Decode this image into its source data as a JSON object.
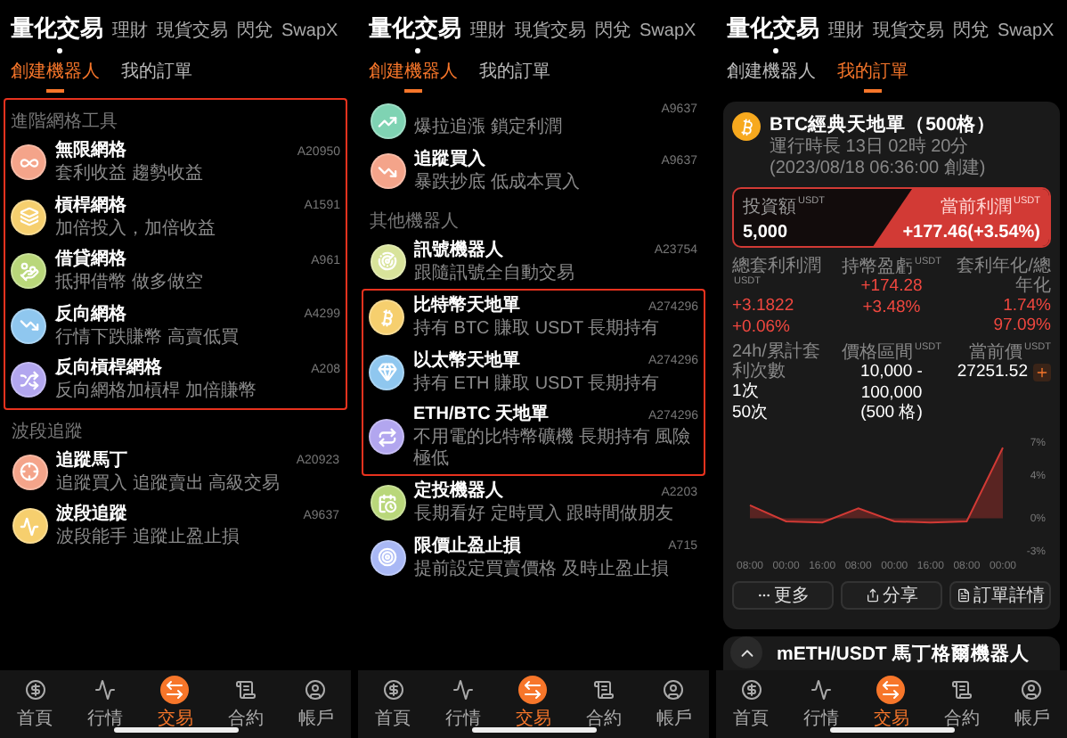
{
  "panels": [
    {
      "kind": "robots",
      "tabs": [
        {
          "label": "量化交易",
          "selected": true
        },
        {
          "label": "理財",
          "selected": false
        },
        {
          "label": "現貨交易",
          "selected": false
        },
        {
          "label": "閃兌",
          "selected": false
        },
        {
          "label": "SwapX",
          "selected": false
        }
      ],
      "subtabs": [
        {
          "label": "創建機器人",
          "selected": true
        },
        {
          "label": "我的訂單",
          "selected": false
        }
      ],
      "list": [
        {
          "kind": "section",
          "label": "進階網格工具",
          "highlighted": true
        },
        {
          "kind": "item",
          "title": "無限網格",
          "subtitle": "套利收益 趨勢收益",
          "code": "A20950",
          "color": "#f4a48a",
          "highlighted": true
        },
        {
          "kind": "item",
          "title": "槓桿網格",
          "subtitle": "加倍投入，加倍收益",
          "code": "A1591",
          "color": "#f6cf6e",
          "highlighted": true
        },
        {
          "kind": "item",
          "title": "借貸網格",
          "subtitle": "抵押借幣 做多做空",
          "code": "A961",
          "color": "#b9d77a",
          "highlighted": true
        },
        {
          "kind": "item",
          "title": "反向網格",
          "subtitle": "行情下跌賺幣 高賣低買",
          "code": "A4299",
          "color": "#8fc7ef",
          "highlighted": true
        },
        {
          "kind": "item",
          "title": "反向槓桿網格",
          "subtitle": "反向網格加槓桿 加倍賺幣",
          "code": "A208",
          "color": "#b2a6ef",
          "highlighted": true
        },
        {
          "kind": "section",
          "label": "波段追蹤",
          "highlighted": false
        },
        {
          "kind": "item",
          "title": "追蹤馬丁",
          "subtitle": "追蹤買入 追蹤賣出 高級交易",
          "code": "A20923",
          "color": "#f4a48a",
          "highlighted": false
        },
        {
          "kind": "item",
          "title": "波段追蹤",
          "subtitle": "波段能手 追蹤止盈止損",
          "code": "A9637",
          "color": "#f6cf6e",
          "highlighted": false
        }
      ],
      "nav": [
        {
          "label": "首頁",
          "selected": false
        },
        {
          "label": "行情",
          "selected": false
        },
        {
          "label": "交易",
          "selected": true
        },
        {
          "label": "合約",
          "selected": false
        },
        {
          "label": "帳戶",
          "selected": false
        }
      ]
    },
    {
      "kind": "robots",
      "tabs": [
        {
          "label": "量化交易",
          "selected": true
        },
        {
          "label": "理財",
          "selected": false
        },
        {
          "label": "現貨交易",
          "selected": false
        },
        {
          "label": "閃兌",
          "selected": false
        },
        {
          "label": "SwapX",
          "selected": false
        }
      ],
      "subtabs": [
        {
          "label": "創建機器人",
          "selected": true
        },
        {
          "label": "我的訂單",
          "selected": false
        }
      ],
      "list": [
        {
          "kind": "item",
          "subtitle": "爆拉追漲 鎖定利潤",
          "code": "A9637",
          "color": "#7fd3b3",
          "highlighted": false
        },
        {
          "kind": "item",
          "title": "追蹤買入",
          "subtitle": "暴跌抄底 低成本買入",
          "code": "A9637",
          "color": "#f4a48a",
          "highlighted": false
        },
        {
          "kind": "section",
          "label": "其他機器人",
          "highlighted": false
        },
        {
          "kind": "item",
          "title": "訊號機器人",
          "subtitle": "跟隨訊號全自動交易",
          "code": "A23754",
          "color": "#d8e39a",
          "highlighted": false
        },
        {
          "kind": "item",
          "title": "比特幣天地單",
          "subtitle": "持有 BTC 賺取 USDT 長期持有",
          "code": "A274296",
          "color": "#f6cf6e",
          "highlighted": true
        },
        {
          "kind": "item",
          "title": "以太幣天地單",
          "subtitle": "持有 ETH 賺取 USDT 長期持有",
          "code": "A274296",
          "color": "#8fc7ef",
          "highlighted": true
        },
        {
          "kind": "item",
          "title": "ETH/BTC 天地單",
          "subtitle": "不用電的比特幣礦機 長期持有 風險極低",
          "code": "A274296",
          "color": "#b2a6ef",
          "highlighted": true
        },
        {
          "kind": "item",
          "title": "定投機器人",
          "subtitle": "長期看好 定時買入 跟時間做朋友",
          "code": "A2203",
          "color": "#b9d77a",
          "highlighted": false
        },
        {
          "kind": "item",
          "title": "限價止盈止損",
          "subtitle": "提前設定買賣價格 及時止盈止損",
          "code": "A715",
          "color": "#a9b8f5",
          "highlighted": false
        }
      ],
      "nav": [
        {
          "label": "首頁",
          "selected": false
        },
        {
          "label": "行情",
          "selected": false
        },
        {
          "label": "交易",
          "selected": true
        },
        {
          "label": "合約",
          "selected": false
        },
        {
          "label": "帳戶",
          "selected": false
        }
      ]
    },
    {
      "kind": "orders",
      "tabs": [
        {
          "label": "量化交易",
          "selected": true
        },
        {
          "label": "理財",
          "selected": false
        },
        {
          "label": "現貨交易",
          "selected": false
        },
        {
          "label": "閃兌",
          "selected": false
        },
        {
          "label": "SwapX",
          "selected": false
        }
      ],
      "subtabs": [
        {
          "label": "創建機器人",
          "selected": false
        },
        {
          "label": "我的訂單",
          "selected": true
        }
      ],
      "order": {
        "title": "BTC經典天地單（500格）",
        "runtime": "運行時長 13日 02時 20分(2023/08/18 06:36:00 創建)",
        "investment": {
          "label": "投資額",
          "unit": "USDT",
          "value": "5,000"
        },
        "profit": {
          "label": "當前利潤",
          "unit": "USDT",
          "value": "+177.46(+3.54%)"
        },
        "stats": [
          {
            "kind": "stat",
            "label": "總套利利潤",
            "unit": "USDT",
            "values": [
              "+3.1822",
              "+0.06%"
            ],
            "positive": true
          },
          {
            "kind": "stat",
            "label": "持幣盈虧",
            "unit": "USDT",
            "values": [
              "+174.28",
              "+3.48%"
            ],
            "positive": true
          },
          {
            "kind": "stat",
            "label": "套利年化/總年化",
            "values": [
              "1.74%",
              "97.09%"
            ],
            "positive": true
          },
          {
            "kind": "stat",
            "label": "24h/累計套利次數",
            "values": [
              "1次",
              "50次"
            ],
            "positive": false
          },
          {
            "kind": "stat",
            "label": "價格區間",
            "unit": "USDT",
            "values": [
              "10,000 -",
              "100,000",
              "(500 格)"
            ],
            "positive": false
          },
          {
            "kind": "price",
            "label": "當前價",
            "unit": "USDT",
            "values": [
              "27251.52"
            ],
            "positive": false
          }
        ],
        "chart_data": {
          "type": "area",
          "categories": [
            "08:00",
            "00:00",
            "16:00",
            "08:00",
            "00:00",
            "16:00",
            "08:00",
            "00:00"
          ],
          "series": [
            {
              "color": "#d23a35",
              "values": [
                1.2,
                -0.3,
                -0.4,
                0.9,
                -0.3,
                -0.4,
                -0.3,
                6.5
              ]
            }
          ],
          "ylim": [
            -3,
            7
          ],
          "yticks": [
            {
              "value": 7,
              "label": "7%"
            },
            {
              "value": 4,
              "label": "4%"
            },
            {
              "value": 0,
              "label": "0%"
            },
            {
              "value": -3,
              "label": "-3%"
            }
          ]
        },
        "actions": [
          "更多",
          "分享",
          "訂單詳情"
        ]
      },
      "next_order": {
        "title": "mETH/USDT 馬丁格爾機器人"
      },
      "nav": [
        {
          "label": "首頁",
          "selected": false
        },
        {
          "label": "行情",
          "selected": false
        },
        {
          "label": "交易",
          "selected": true
        },
        {
          "label": "合約",
          "selected": false
        },
        {
          "label": "帳戶",
          "selected": false
        }
      ]
    }
  ]
}
